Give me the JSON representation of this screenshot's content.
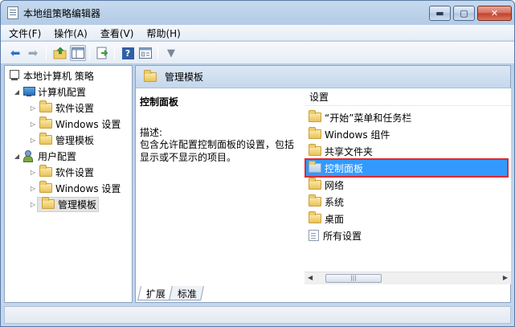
{
  "window": {
    "title": "本地组策略编辑器",
    "minimize_glyph": "▬",
    "maximize_glyph": "▢",
    "close_glyph": "✕"
  },
  "menu": [
    {
      "label": "文件(F)"
    },
    {
      "label": "操作(A)"
    },
    {
      "label": "查看(V)"
    },
    {
      "label": "帮助(H)"
    }
  ],
  "toolbar": {
    "icons": [
      "back-arrow-icon",
      "forward-arrow-icon",
      "up-folder-icon",
      "show-hide-tree-icon",
      "export-list-icon",
      "help-icon",
      "properties-icon",
      "filter-icon"
    ],
    "glyphs": {
      "back": "⬅",
      "forward": "➡",
      "help": "?",
      "filter": "▼"
    }
  },
  "tree": {
    "root": "本地计算机 策略",
    "computer_config": "计算机配置",
    "user_config": "用户配置",
    "computer_children": [
      "软件设置",
      "Windows 设置",
      "管理模板"
    ],
    "user_children": [
      "软件设置",
      "Windows 设置",
      "管理模板"
    ]
  },
  "right_pane": {
    "header_title": "管理模板",
    "desc_title": "控制面板",
    "desc_label": "描述:",
    "desc_text": "包含允许配置控制面板的设置，包括显示或不显示的项目。",
    "list_header": "设置",
    "items": [
      {
        "label": "“开始”菜单和任务栏",
        "icon": "folder-icon"
      },
      {
        "label": "Windows 组件",
        "icon": "folder-icon"
      },
      {
        "label": "共享文件夹",
        "icon": "folder-icon"
      },
      {
        "label": "控制面板",
        "icon": "folder-icon",
        "selected": true
      },
      {
        "label": "网络",
        "icon": "folder-icon"
      },
      {
        "label": "系统",
        "icon": "folder-icon"
      },
      {
        "label": "桌面",
        "icon": "folder-icon"
      },
      {
        "label": "所有设置",
        "icon": "settings-page-icon"
      }
    ],
    "tabs": [
      {
        "label": "扩展"
      },
      {
        "label": "标准"
      }
    ],
    "scroll_left": "◀",
    "scroll_right": "▶",
    "scroll_thumb": "|||"
  },
  "colors": {
    "selection": "#3399ff",
    "highlight_border": "#e0282d",
    "titlebar": "#c6d9ee"
  }
}
